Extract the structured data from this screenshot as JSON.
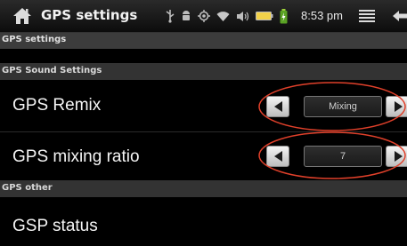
{
  "status_bar": {
    "app_title": "GPS settings",
    "time": "8:53 pm",
    "icons": [
      "home-icon",
      "usb-icon",
      "android-debug-icon",
      "gps-icon",
      "wifi-icon",
      "volume-icon",
      "battery-icon",
      "battery-charging-icon",
      "menu-icon",
      "back-icon"
    ]
  },
  "page": {
    "header": "GPS settings"
  },
  "sections": {
    "sound": {
      "header": "GPS Sound Settings",
      "gps_remix": {
        "label": "GPS Remix",
        "value": "Mixing"
      },
      "gps_mixing_ratio": {
        "label": "GPS mixing ratio",
        "value": "7"
      }
    },
    "other": {
      "header": "GPS other",
      "gsp_status": {
        "label": "GSP status"
      }
    }
  },
  "colors": {
    "annotation_ellipse": "#e0402a",
    "section_header_bg": "#333333",
    "background": "#000000"
  }
}
